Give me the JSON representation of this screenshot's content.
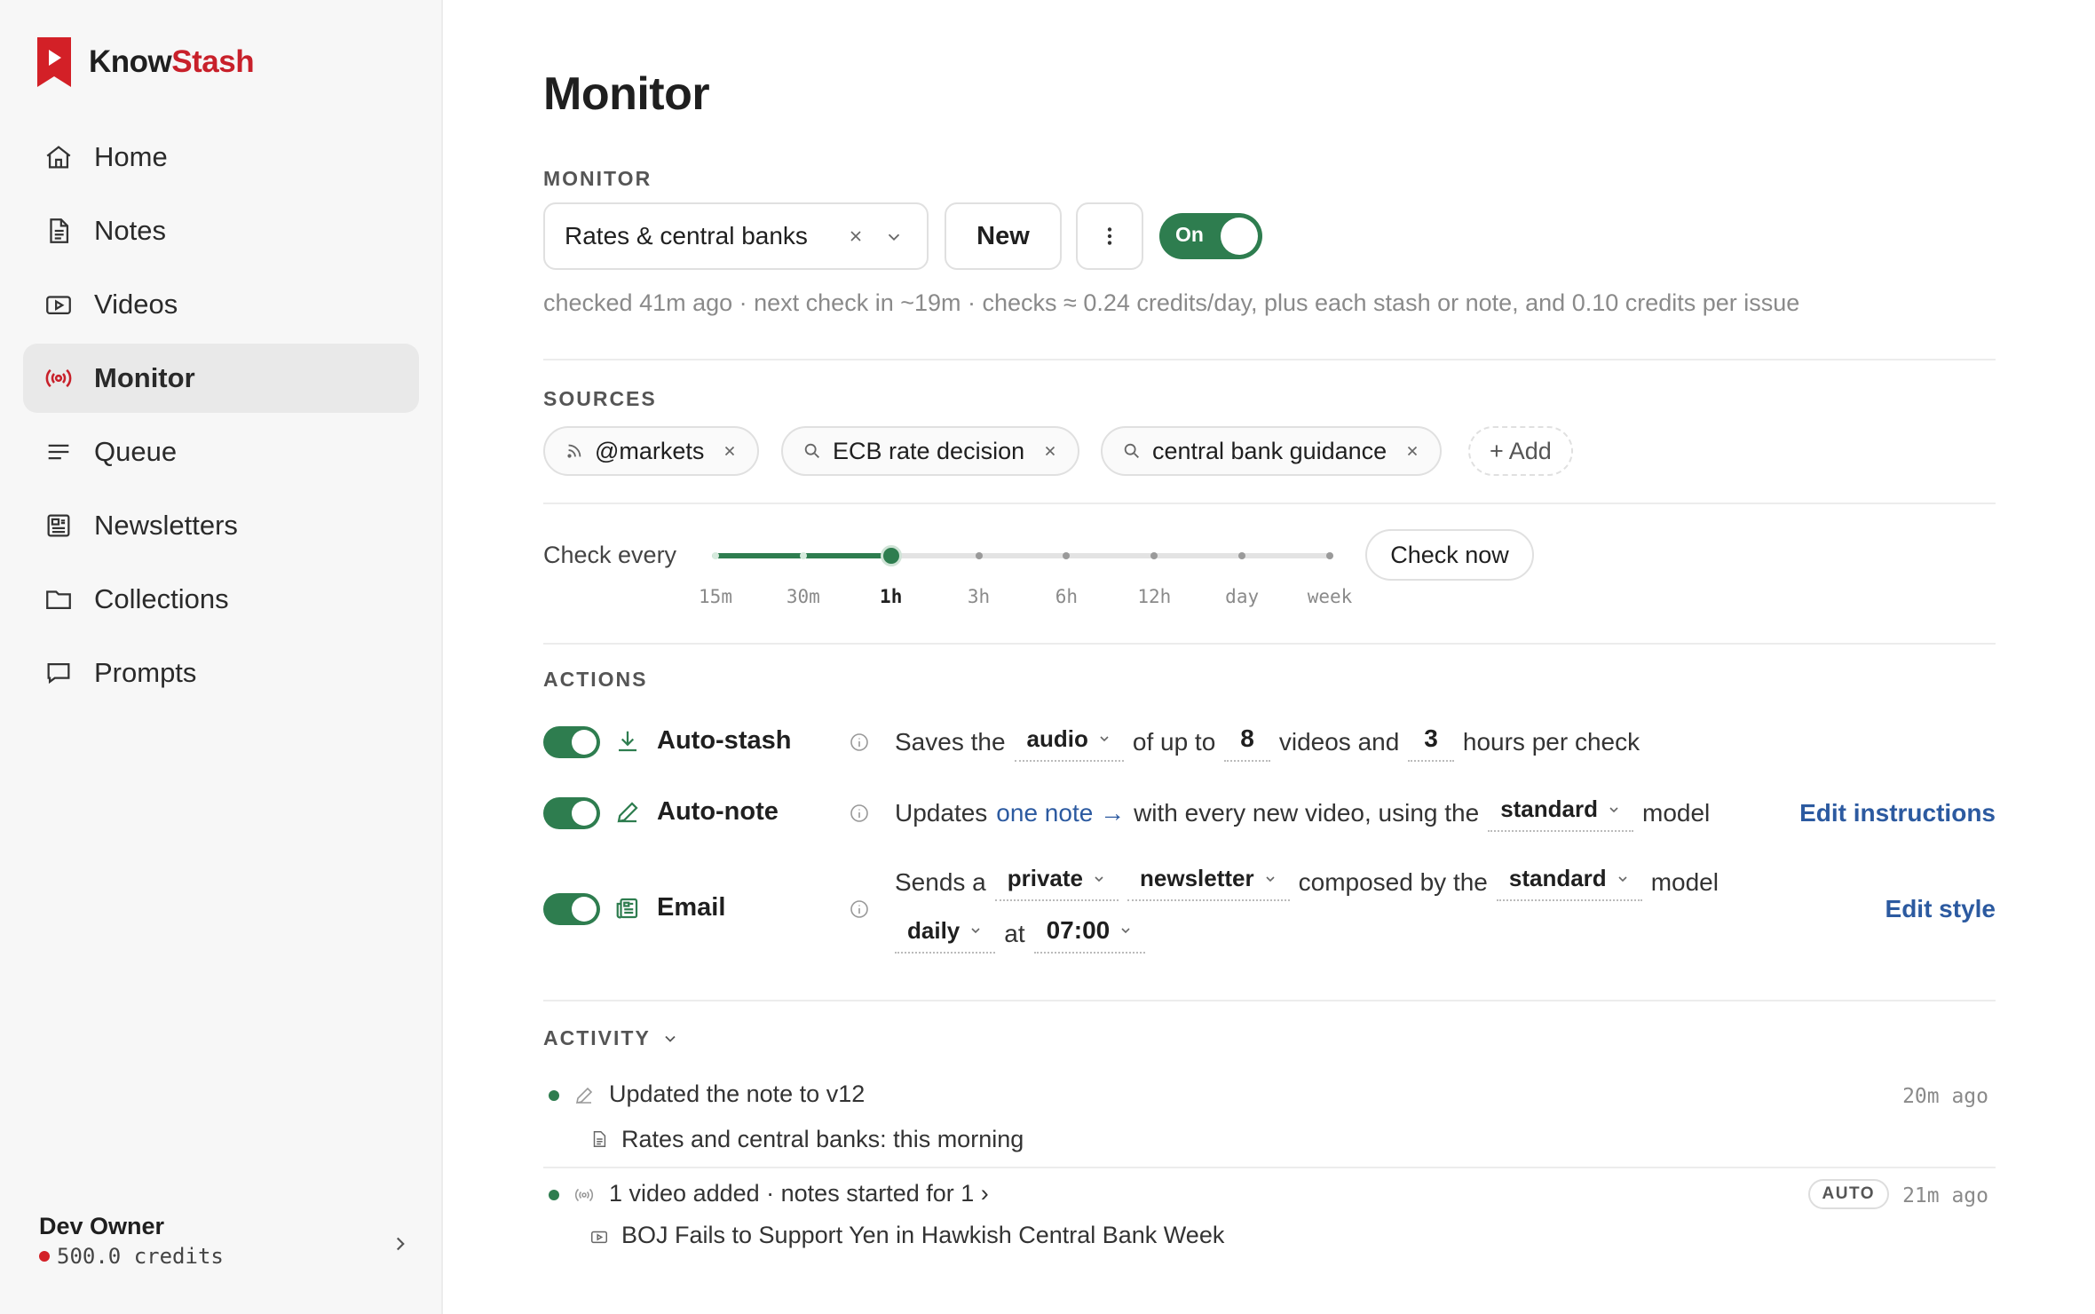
{
  "app": {
    "brand_part1": "Know",
    "brand_part2": "Stash",
    "brand_color": "#c8202a",
    "accent_color": "#2e7d4f"
  },
  "sidebar": {
    "items": [
      {
        "label": "Home",
        "icon": "home-icon"
      },
      {
        "label": "Notes",
        "icon": "document-icon"
      },
      {
        "label": "Videos",
        "icon": "video-icon"
      },
      {
        "label": "Monitor",
        "icon": "broadcast-icon",
        "active": true
      },
      {
        "label": "Queue",
        "icon": "list-icon"
      },
      {
        "label": "Newsletters",
        "icon": "newspaper-icon"
      },
      {
        "label": "Collections",
        "icon": "folder-icon"
      },
      {
        "label": "Prompts",
        "icon": "chat-icon"
      }
    ],
    "account": {
      "name": "Dev Owner",
      "credits": "500.0 credits"
    }
  },
  "page": {
    "title": "Monitor"
  },
  "monitor": {
    "section_label": "MONITOR",
    "selected": "Rates & central banks",
    "new_label": "New",
    "toggle_label": "On",
    "status_line": "checked 41m ago · next check in ~19m · checks ≈ 0.24 credits/day, plus each stash or note, and 0.10 credits per issue"
  },
  "sources": {
    "section_label": "SOURCES",
    "chips": [
      {
        "label": "@markets",
        "icon": "rss-icon"
      },
      {
        "label": "ECB rate decision",
        "icon": "search-icon"
      },
      {
        "label": "central bank guidance",
        "icon": "search-icon"
      }
    ],
    "add_label": "+ Add"
  },
  "schedule": {
    "label": "Check every",
    "options": [
      "15m",
      "30m",
      "1h",
      "3h",
      "6h",
      "12h",
      "day",
      "week"
    ],
    "selected_index": 2,
    "check_now_label": "Check now"
  },
  "actions": {
    "section_label": "ACTIONS",
    "auto_stash": {
      "name": "Auto-stash",
      "enabled": true,
      "t1": "Saves the",
      "media": "audio",
      "t2": "of up to",
      "count": "8",
      "t3": "videos and",
      "hours": "3",
      "t4": "hours per check"
    },
    "auto_note": {
      "name": "Auto-note",
      "enabled": true,
      "t1": "Updates",
      "link": "one note →",
      "t2": "with every new video, using the",
      "model": "standard",
      "t3": "model",
      "edit_label": "Edit instructions"
    },
    "email": {
      "name": "Email",
      "enabled": true,
      "t1": "Sends a",
      "visibility": "private",
      "kind": "newsletter",
      "t2": "composed by the",
      "model": "standard",
      "t3": "model",
      "frequency": "daily",
      "t4": "at",
      "time": "07:00",
      "edit_label": "Edit style"
    }
  },
  "activity": {
    "section_label": "ACTIVITY",
    "items": [
      {
        "text": "Updated the note to v12",
        "time": "20m ago",
        "sub": "Rates and central banks: this morning"
      },
      {
        "text": "1 video added · notes started for 1 ›",
        "badge": "AUTO",
        "time": "21m ago",
        "sub": "BOJ Fails to Support Yen in Hawkish Central Bank Week"
      }
    ]
  }
}
